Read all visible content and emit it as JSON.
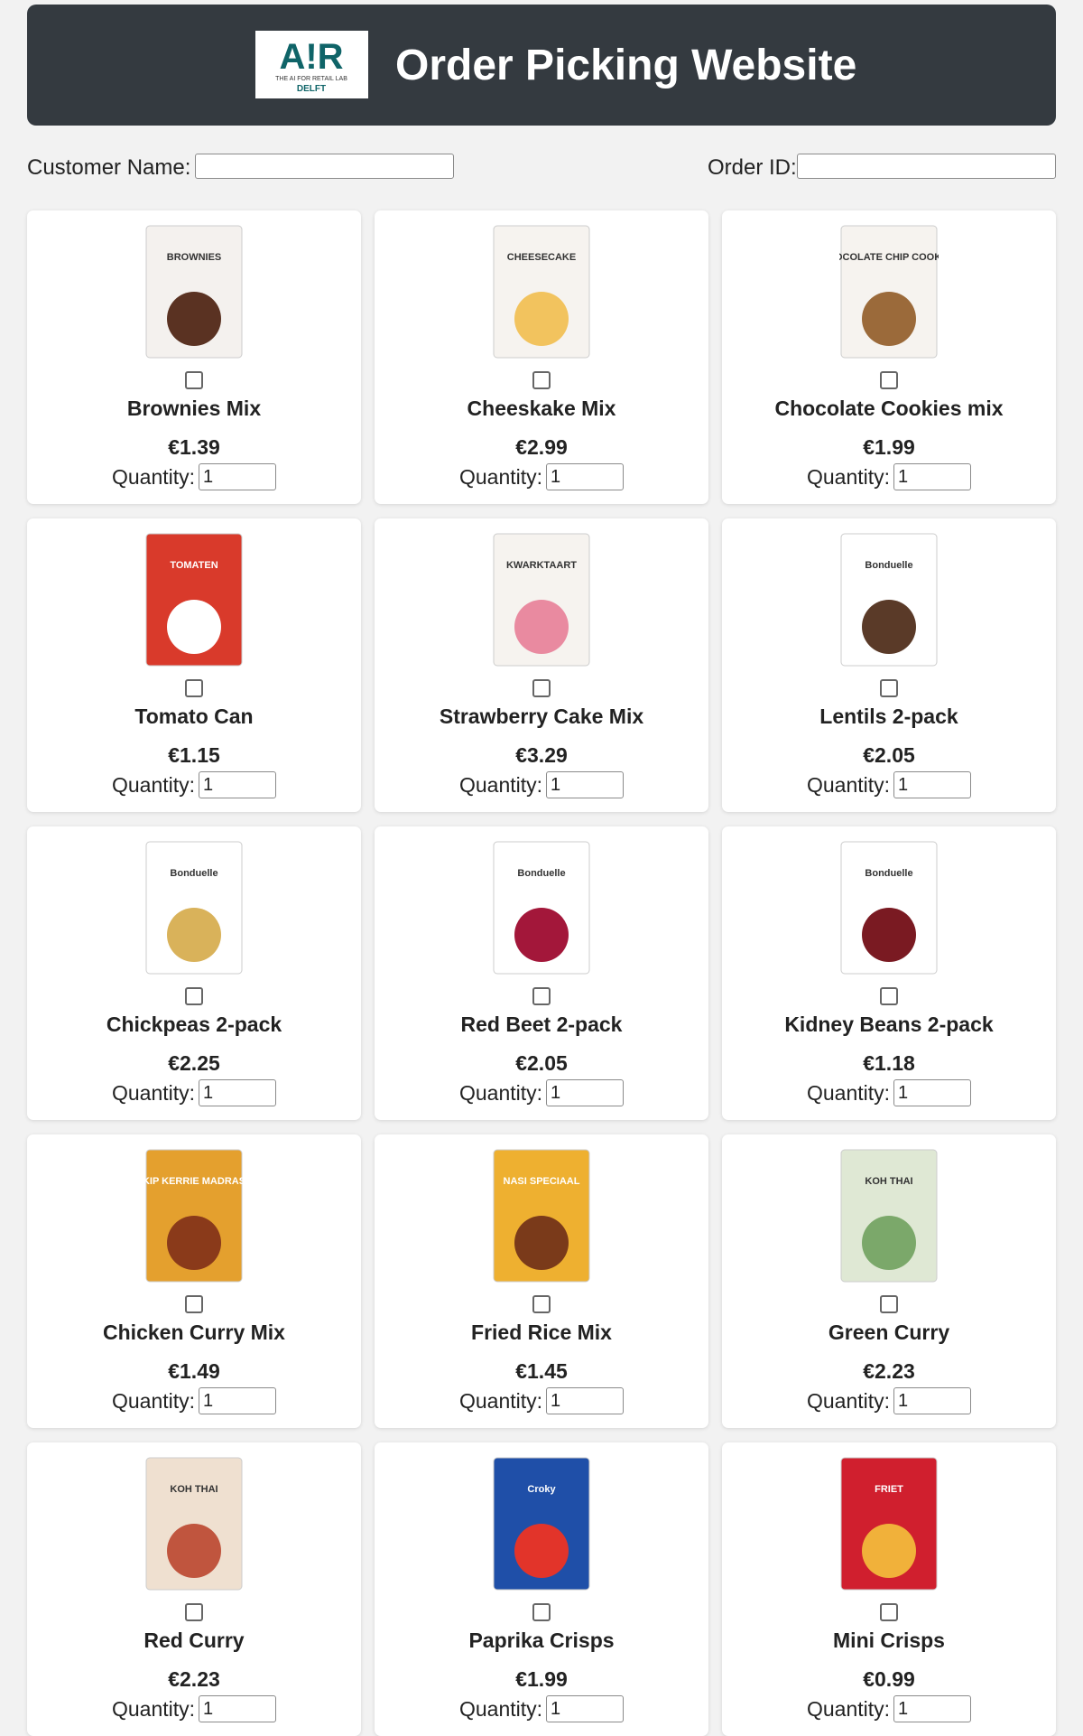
{
  "header": {
    "title": "Order Picking Website",
    "logo_text": "A!R",
    "logo_subtext": "THE AI FOR RETAIL LAB",
    "logo_city": "DELFT"
  },
  "form": {
    "customer_label": "Customer Name:",
    "customer_value": "",
    "order_label": "Order ID:",
    "order_value": ""
  },
  "products": [
    {
      "name": "Brownies Mix",
      "price": "€1.39",
      "quantity_label": "Quantity:",
      "quantity": "1",
      "checked": false,
      "package_text": "BROWNIES",
      "package_color": "#f4f1ee",
      "accent": "#5a3222"
    },
    {
      "name": "Cheeskake Mix",
      "price": "€2.99",
      "quantity_label": "Quantity:",
      "quantity": "1",
      "checked": false,
      "package_text": "CHEESECAKE",
      "package_color": "#f6f3ef",
      "accent": "#f2c35e"
    },
    {
      "name": "Chocolate Cookies mix",
      "price": "€1.99",
      "quantity_label": "Quantity:",
      "quantity": "1",
      "checked": false,
      "package_text": "CHOCOLATE CHIP COOKIES",
      "package_color": "#f6f3ef",
      "accent": "#9b6a3a"
    },
    {
      "name": "Tomato Can",
      "price": "€1.15",
      "quantity_label": "Quantity:",
      "quantity": "1",
      "checked": false,
      "package_text": "TOMATEN",
      "package_color": "#d93a2b",
      "accent": "#ffffff"
    },
    {
      "name": "Strawberry Cake Mix",
      "price": "€3.29",
      "quantity_label": "Quantity:",
      "quantity": "1",
      "checked": false,
      "package_text": "KWARKTAART",
      "package_color": "#f6f3ef",
      "accent": "#e98aa0"
    },
    {
      "name": "Lentils 2-pack",
      "price": "€2.05",
      "quantity_label": "Quantity:",
      "quantity": "1",
      "checked": false,
      "package_text": "Bonduelle",
      "package_color": "#ffffff",
      "accent": "#5a3a28"
    },
    {
      "name": "Chickpeas 2-pack",
      "price": "€2.25",
      "quantity_label": "Quantity:",
      "quantity": "1",
      "checked": false,
      "package_text": "Bonduelle",
      "package_color": "#ffffff",
      "accent": "#d9b25a"
    },
    {
      "name": "Red Beet 2-pack",
      "price": "€2.05",
      "quantity_label": "Quantity:",
      "quantity": "1",
      "checked": false,
      "package_text": "Bonduelle",
      "package_color": "#ffffff",
      "accent": "#a3173a"
    },
    {
      "name": "Kidney Beans 2-pack",
      "price": "€1.18",
      "quantity_label": "Quantity:",
      "quantity": "1",
      "checked": false,
      "package_text": "Bonduelle",
      "package_color": "#ffffff",
      "accent": "#7a1a22"
    },
    {
      "name": "Chicken Curry Mix",
      "price": "€1.49",
      "quantity_label": "Quantity:",
      "quantity": "1",
      "checked": false,
      "package_text": "KIP KERRIE MADRAS",
      "package_color": "#e4a02e",
      "accent": "#8a3a1a"
    },
    {
      "name": "Fried Rice Mix",
      "price": "€1.45",
      "quantity_label": "Quantity:",
      "quantity": "1",
      "checked": false,
      "package_text": "NASI SPECIAAL",
      "package_color": "#eeb030",
      "accent": "#7a3a1a"
    },
    {
      "name": "Green Curry",
      "price": "€2.23",
      "quantity_label": "Quantity:",
      "quantity": "1",
      "checked": false,
      "package_text": "KOH THAI",
      "package_color": "#dfe8d4",
      "accent": "#7ba86a"
    },
    {
      "name": "Red Curry",
      "price": "€2.23",
      "quantity_label": "Quantity:",
      "quantity": "1",
      "checked": false,
      "package_text": "KOH THAI",
      "package_color": "#efe0d0",
      "accent": "#c0553e"
    },
    {
      "name": "Paprika Crisps",
      "price": "€1.99",
      "quantity_label": "Quantity:",
      "quantity": "1",
      "checked": false,
      "package_text": "Croky",
      "package_color": "#1f4fa8",
      "accent": "#e2342a"
    },
    {
      "name": "Mini Crisps",
      "price": "€0.99",
      "quantity_label": "Quantity:",
      "quantity": "1",
      "checked": false,
      "package_text": "FRIET",
      "package_color": "#d01f2e",
      "accent": "#f1b13a"
    }
  ]
}
